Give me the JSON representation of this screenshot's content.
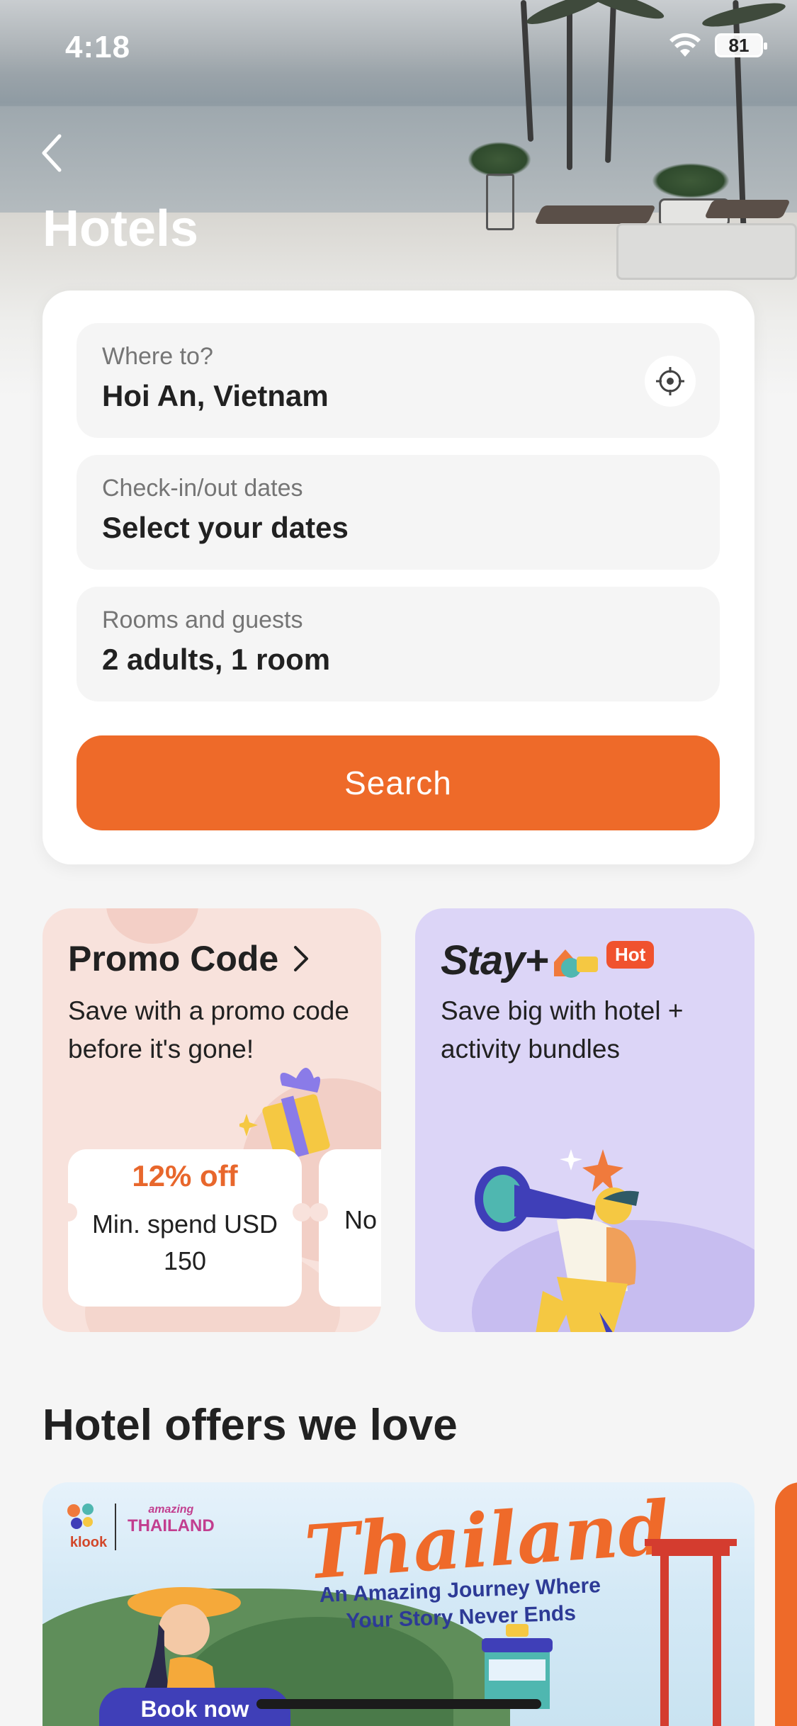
{
  "status_bar": {
    "time": "4:18",
    "battery": "81"
  },
  "header": {
    "title": "Hotels"
  },
  "search": {
    "destination_label": "Where to?",
    "destination_value": "Hoi An, Vietnam",
    "dates_label": "Check-in/out dates",
    "dates_value": "Select your dates",
    "guests_label": "Rooms and guests",
    "guests_value": "2  adults, 1  room",
    "search_button": "Search"
  },
  "promo": {
    "title": "Promo Code",
    "description": "Save with a promo code before it's gone!",
    "coupons": [
      {
        "title": "12% off",
        "description": "Min. spend USD 150"
      },
      {
        "title": "",
        "description": "No"
      }
    ]
  },
  "stay_plus": {
    "logo": "Stay+",
    "badge": "Hot",
    "description": "Save big with hotel + activity bundles"
  },
  "offers": {
    "section_title": "Hotel offers we love",
    "banner": {
      "brand": "klook",
      "partner_small": "amazing",
      "partner": "THAILAND",
      "headline": "Thailand",
      "subline": "An Amazing Journey Where Your Story Never Ends",
      "cta": "Book now"
    }
  },
  "colors": {
    "accent": "#ee6a29",
    "promo_bg": "#f8e2dc",
    "stay_bg": "#dcd5f7"
  }
}
